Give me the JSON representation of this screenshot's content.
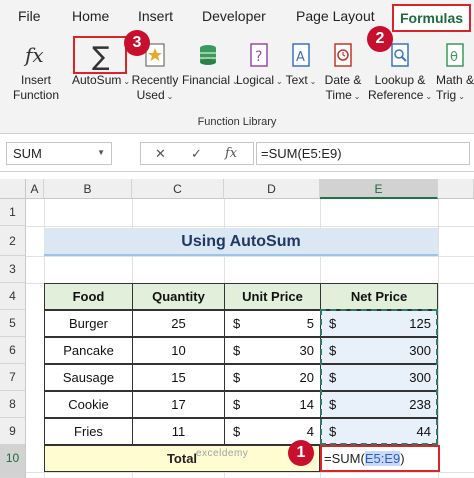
{
  "ribbon_tabs": [
    "File",
    "Home",
    "Insert",
    "Developer",
    "Page Layout",
    "Formulas"
  ],
  "ribbon_buttons": {
    "insert_function": [
      "Insert",
      "Function"
    ],
    "autosum": "AutoSum",
    "recently_used": [
      "Recently",
      "Used"
    ],
    "financial": "Financial",
    "logical": "Logical",
    "text": "Text",
    "date_time": [
      "Date &",
      "Time"
    ],
    "lookup_reference": [
      "Lookup &",
      "Reference"
    ],
    "math_trig": [
      "Math &",
      "Trig"
    ]
  },
  "group_label": "Function Library",
  "badges": [
    "1",
    "2",
    "3"
  ],
  "formula_bar": {
    "name_box": "SUM",
    "cancel_icon": "✕",
    "enter_icon": "✓",
    "fx_icon": "fx",
    "formula": "=SUM(E5:E9)"
  },
  "columns": [
    "A",
    "B",
    "C",
    "D",
    "E"
  ],
  "rows": [
    "1",
    "2",
    "3",
    "4",
    "5",
    "6",
    "7",
    "8",
    "9",
    "10"
  ],
  "sheet": {
    "title": "Using AutoSum",
    "headers": [
      "Food",
      "Quantity",
      "Unit Price",
      "Net Price"
    ],
    "data": [
      {
        "food": "Burger",
        "qty": "25",
        "unit": "5",
        "net": "125"
      },
      {
        "food": "Pancake",
        "qty": "10",
        "unit": "30",
        "net": "300"
      },
      {
        "food": "Sausage",
        "qty": "15",
        "unit": "20",
        "net": "300"
      },
      {
        "food": "Cookie",
        "qty": "17",
        "unit": "14",
        "net": "238"
      },
      {
        "food": "Fries",
        "qty": "11",
        "unit": "4",
        "net": "44"
      }
    ],
    "currency": "$",
    "total_label": "Total",
    "edit_prefix": "=SUM(",
    "edit_ref": "E5:E9",
    "edit_suffix": ")"
  },
  "watermark": "exceldemy",
  "colors": {
    "accent_red": "#d9252a",
    "excel_green": "#217346",
    "header_fill": "#e2efda",
    "total_fill": "#fefcd0"
  }
}
